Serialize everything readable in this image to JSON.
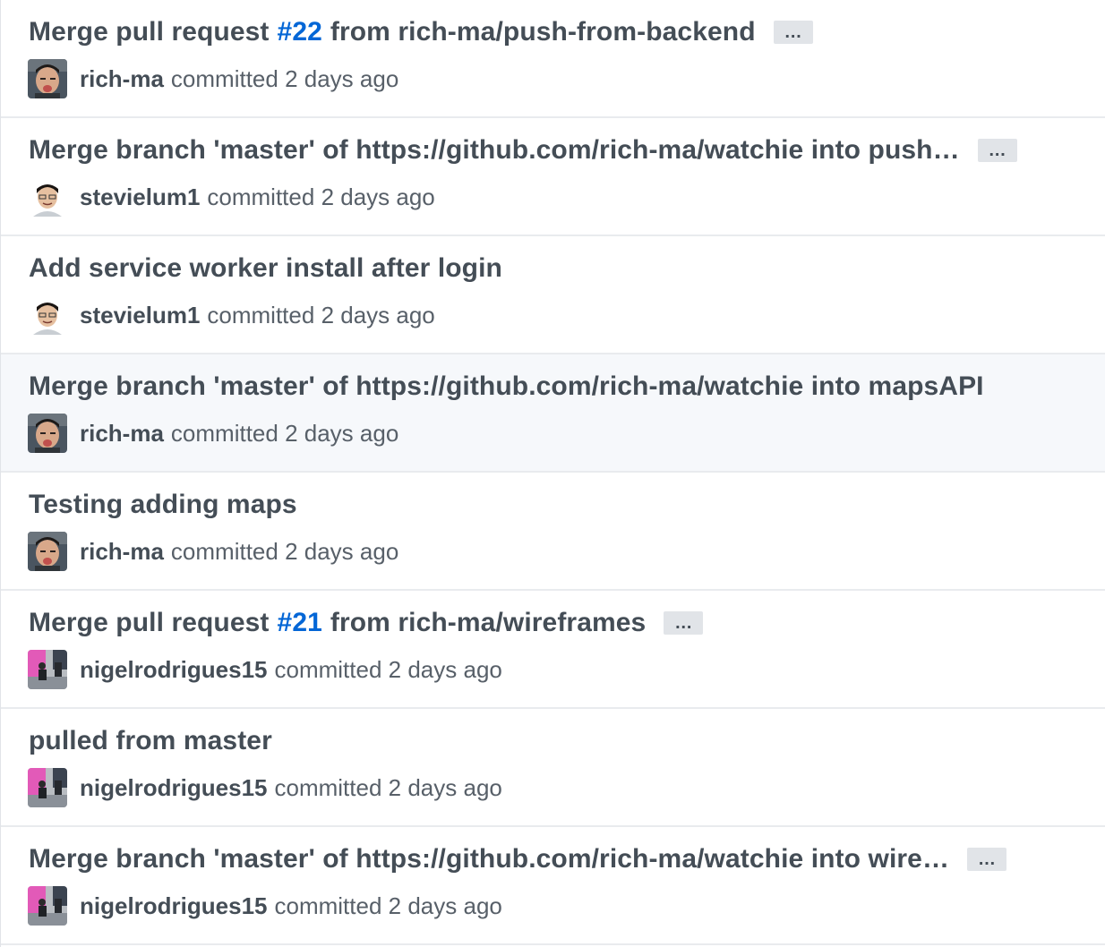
{
  "commits": [
    {
      "title_prefix": "Merge pull request",
      "pr_number": "#22",
      "title_suffix": "from rich-ma/push-from-backend",
      "has_ellipsis": true,
      "author": "rich-ma",
      "avatar_icon": "avatar-rich-ma",
      "committed_label": "committed",
      "time": "2 days ago"
    },
    {
      "title": "Merge branch 'master' of https://github.com/rich-ma/watchie into push…",
      "has_ellipsis": true,
      "author": "stevielum1",
      "avatar_icon": "avatar-stevielum1",
      "committed_label": "committed",
      "time": "2 days ago"
    },
    {
      "title": "Add service worker install after login",
      "has_ellipsis": false,
      "author": "stevielum1",
      "avatar_icon": "avatar-stevielum1",
      "committed_label": "committed",
      "time": "2 days ago"
    },
    {
      "title": "Merge branch 'master' of https://github.com/rich-ma/watchie into mapsAPI",
      "has_ellipsis": false,
      "highlighted": true,
      "author": "rich-ma",
      "avatar_icon": "avatar-rich-ma",
      "committed_label": "committed",
      "time": "2 days ago"
    },
    {
      "title": "Testing adding maps",
      "has_ellipsis": false,
      "author": "rich-ma",
      "avatar_icon": "avatar-rich-ma",
      "committed_label": "committed",
      "time": "2 days ago"
    },
    {
      "title_prefix": "Merge pull request",
      "pr_number": "#21",
      "title_suffix": "from rich-ma/wireframes",
      "has_ellipsis": true,
      "author": "nigelrodrigues15",
      "avatar_icon": "avatar-nigelrodrigues15",
      "committed_label": "committed",
      "time": "2 days ago"
    },
    {
      "title": "pulled from master",
      "has_ellipsis": false,
      "author": "nigelrodrigues15",
      "avatar_icon": "avatar-nigelrodrigues15",
      "committed_label": "committed",
      "time": "2 days ago"
    },
    {
      "title": "Merge branch 'master' of https://github.com/rich-ma/watchie into wire…",
      "has_ellipsis": true,
      "author": "nigelrodrigues15",
      "avatar_icon": "avatar-nigelrodrigues15",
      "committed_label": "committed",
      "time": "2 days ago"
    }
  ],
  "ellipsis_label": "…",
  "colors": {
    "link": "#0366d6",
    "title": "#444d56",
    "meta": "#586069",
    "row_highlight": "#f6f8fb",
    "divider": "#e9ebee"
  }
}
